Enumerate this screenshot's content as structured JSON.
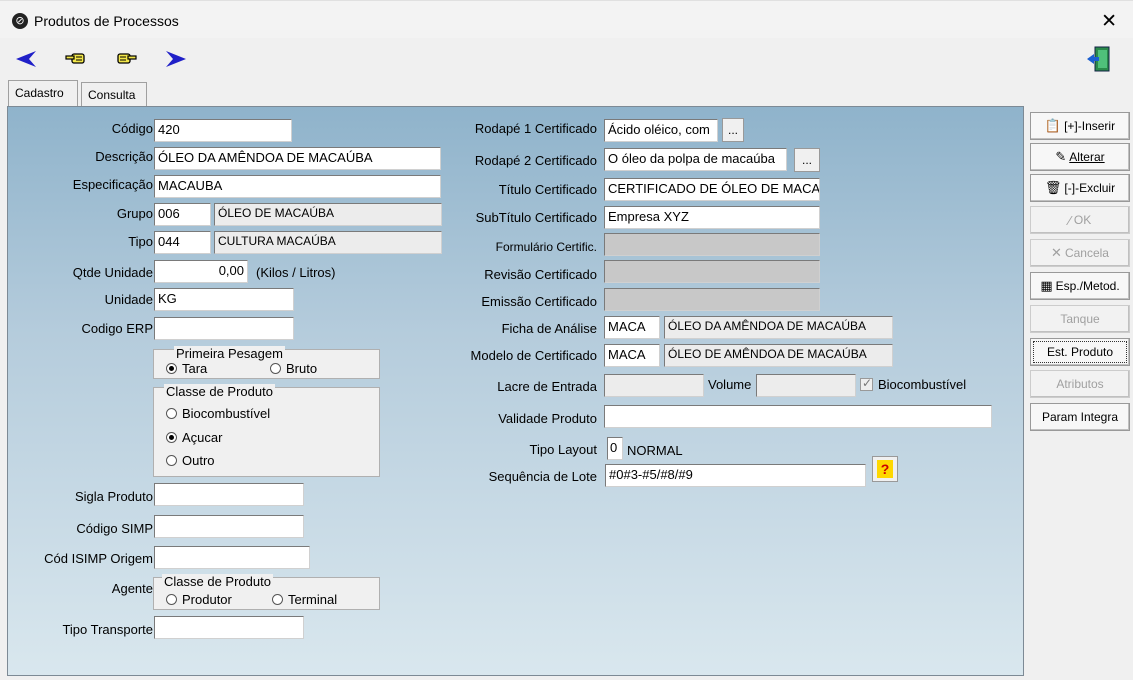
{
  "window": {
    "title": "Produtos de Processos",
    "close": "✕"
  },
  "tabs": [
    {
      "label": "Cadastro"
    },
    {
      "label": "Consulta"
    }
  ],
  "sidebar": {
    "inserir": "[+]-Inserir",
    "alterar": "Alterar",
    "excluir": "[-]-Excluir",
    "ok": "OK",
    "cancela": "Cancela",
    "esp_metod": "Esp./Metod.",
    "tanque": "Tanque",
    "est_produto": "Est. Produto",
    "atributos": "Atributos",
    "param_integra": "Param Integra"
  },
  "left": {
    "codigo": {
      "label": "Código",
      "value": "420"
    },
    "descricao": {
      "label": "Descrição",
      "value": "ÓLEO DA AMÊNDOA DE MACAÚBA"
    },
    "especificacao": {
      "label": "Especificação",
      "value": "MACAUBA"
    },
    "grupo": {
      "label": "Grupo",
      "code": "006",
      "desc": "ÓLEO DE MACAÚBA"
    },
    "tipo": {
      "label": "Tipo",
      "code": "044",
      "desc": "CULTURA MACAÚBA"
    },
    "qtde_unidade": {
      "label": "Qtde Unidade",
      "value": "0,00",
      "suffix": "(Kilos / Litros)"
    },
    "unidade": {
      "label": "Unidade",
      "value": "KG"
    },
    "codigo_erp": {
      "label": "Codigo ERP",
      "value": ""
    },
    "primeira_pesagem": {
      "title": "Primeira Pesagem",
      "tara": "Tara",
      "bruto": "Bruto"
    },
    "classe_produto": {
      "title": "Classe de Produto",
      "bio": "Biocombustível",
      "acucar": "Açucar",
      "outro": "Outro"
    },
    "sigla_produto": {
      "label": "Sigla Produto",
      "value": ""
    },
    "codigo_simp": {
      "label": "Código SIMP",
      "value": ""
    },
    "cod_isimp": {
      "label": "Cód ISIMP Origem",
      "value": ""
    },
    "agente": {
      "label": "Agente",
      "title": "Classe de Produto",
      "produtor": "Produtor",
      "terminal": "Terminal"
    },
    "tipo_transporte": {
      "label": "Tipo Transporte",
      "value": ""
    }
  },
  "right": {
    "rodape1": {
      "label": "Rodapé 1 Certificado",
      "value": "Ácido oléico, com",
      "btn": "..."
    },
    "rodape2": {
      "label": "Rodapé 2 Certificado",
      "value": "O óleo da polpa de macaúba",
      "btn": "..."
    },
    "titulo": {
      "label": "Título Certificado",
      "value": "CERTIFICADO DE ÓLEO DE MACA"
    },
    "subtitulo": {
      "label": "SubTítulo Certificado",
      "value": "Empresa XYZ"
    },
    "formulario": {
      "label": "Formulário Certific.",
      "value": ""
    },
    "revisao": {
      "label": "Revisão Certificado",
      "value": ""
    },
    "emissao": {
      "label": "Emissão Certificado",
      "value": ""
    },
    "ficha": {
      "label": "Ficha de Análise",
      "code": "MACA",
      "desc": "ÓLEO DA AMÊNDOA DE MACAÚBA"
    },
    "modelo": {
      "label": "Modelo de Certificado",
      "code": "MACA",
      "desc": "ÓLEO DE AMÊNDOA DE MACAÚBA"
    },
    "lacre": {
      "label": "Lacre de Entrada",
      "value": "",
      "volume_label": "Volume",
      "volume": "",
      "bio_label": "Biocombustível"
    },
    "validade": {
      "label": "Validade Produto",
      "value": ""
    },
    "tipo_layout": {
      "label": "Tipo Layout",
      "value": "0",
      "desc": "NORMAL"
    },
    "sequencia": {
      "label": "Sequência de Lote",
      "value": "#0#3-#5/#8/#9",
      "help": "?"
    }
  }
}
